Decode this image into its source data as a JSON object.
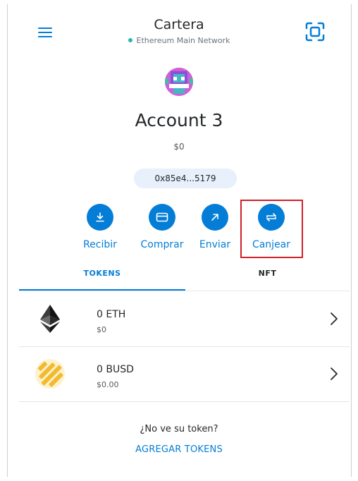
{
  "header": {
    "title": "Cartera",
    "network": "Ethereum Main Network"
  },
  "account": {
    "name": "Account 3",
    "balance": "$0",
    "address": "0x85e4...5179"
  },
  "actions": [
    {
      "label": "Recibir",
      "icon": "download-icon"
    },
    {
      "label": "Comprar",
      "icon": "card-icon"
    },
    {
      "label": "Enviar",
      "icon": "arrow-up-right-icon"
    },
    {
      "label": "Canjear",
      "icon": "swap-icon"
    }
  ],
  "tabs": {
    "tokens": "TOKENS",
    "nft": "NFT"
  },
  "tokens": [
    {
      "amount": "0 ETH",
      "fiat": "$0",
      "icon": "eth-logo"
    },
    {
      "amount": "0 BUSD",
      "fiat": "$0.00",
      "icon": "busd-logo"
    }
  ],
  "footer": {
    "prompt": "¿No ve su token?",
    "add_link": "AGREGAR TOKENS"
  },
  "colors": {
    "accent": "#037dd6",
    "highlight": "#d0202b"
  }
}
